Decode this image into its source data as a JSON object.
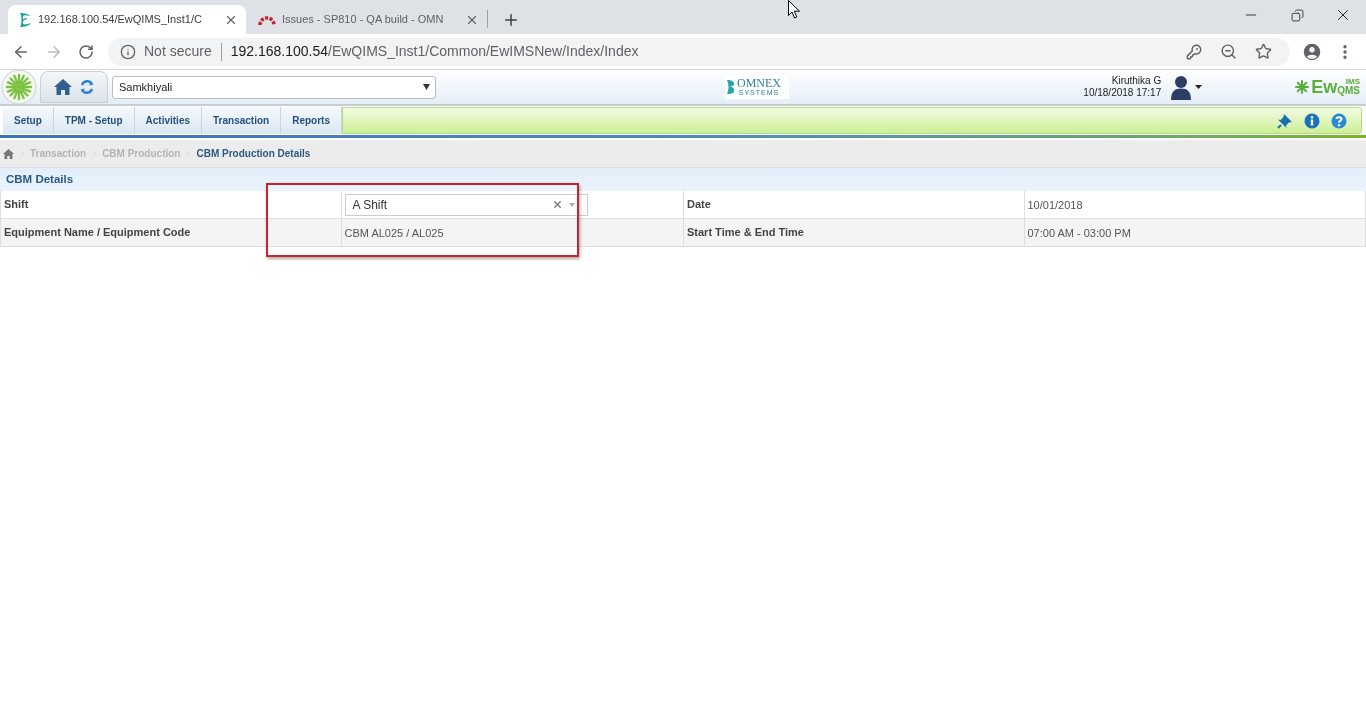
{
  "browser": {
    "tabs": [
      {
        "title": "192.168.100.54/EwQIMS_Inst1/C",
        "selected": true
      },
      {
        "title": "Issues - SP810 - QA build - OMN",
        "selected": false
      }
    ],
    "address": {
      "security": "Not secure",
      "host": "192.168.100.54",
      "path": "/EwQIMS_Inst1/Common/EwIMSNew/Index/Index"
    }
  },
  "header": {
    "site_select": {
      "value": "Samkhiyali"
    },
    "company_logo": {
      "name": "OMNEX",
      "tagline": "SYSTEMS"
    },
    "user": {
      "name": "Kiruthika G",
      "datetime": "10/18/2018 17:17"
    },
    "product_logo": {
      "prefix": "Ew",
      "superscript": "IMS",
      "subscript": "QMS"
    }
  },
  "menu": [
    "Setup",
    "TPM - Setup",
    "Activities",
    "Transaction",
    "Reports"
  ],
  "breadcrumb": [
    {
      "label": "Transaction",
      "current": false
    },
    {
      "label": "CBM Production",
      "current": false
    },
    {
      "label": "CBM Production Details",
      "current": true
    }
  ],
  "section": {
    "title": "CBM Details",
    "rows": [
      [
        {
          "label": "Shift",
          "kind": "select",
          "value": "A Shift"
        },
        {
          "label": "Date",
          "kind": "text",
          "value": "10/01/2018"
        }
      ],
      [
        {
          "label": "Equipment Name / Equipment Code",
          "kind": "text",
          "value": "CBM AL025 / AL025"
        },
        {
          "label": "Start Time & End Time",
          "kind": "text",
          "value": "07:00 AM - 03:00 PM"
        }
      ]
    ]
  }
}
